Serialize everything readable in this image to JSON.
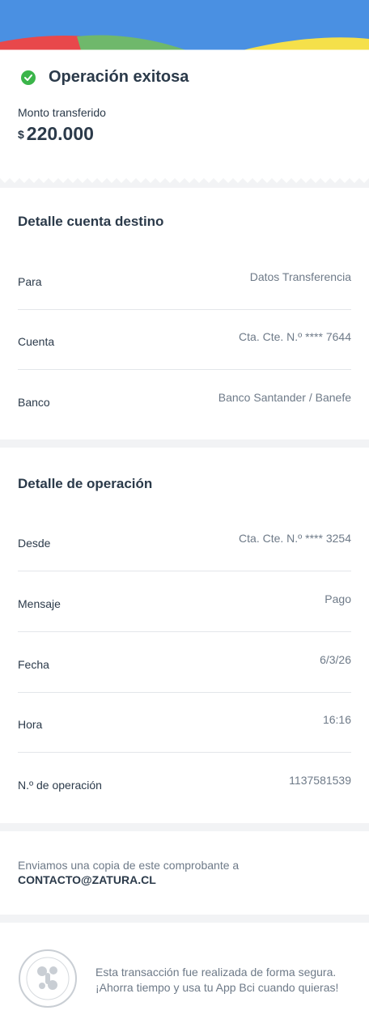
{
  "header": {
    "colors": {
      "blue": "#4a90e2",
      "red": "#e8484b",
      "green": "#6fb86b",
      "yellow": "#f5e04a"
    }
  },
  "status": {
    "title": "Operación exitosa",
    "icon": "check-circle-icon"
  },
  "amount": {
    "label": "Monto transferido",
    "currency": "$",
    "value": "220.000"
  },
  "destino": {
    "title": "Detalle cuenta destino",
    "rows": [
      {
        "label": "Para",
        "value": "Datos Transferencia"
      },
      {
        "label": "Cuenta",
        "value": "Cta. Cte. N.º **** 7644"
      },
      {
        "label": "Banco",
        "value": "Banco Santander / Banefe"
      }
    ]
  },
  "operacion": {
    "title": "Detalle de operación",
    "rows": [
      {
        "label": "Desde",
        "value": "Cta. Cte. N.º **** 3254"
      },
      {
        "label": "Mensaje",
        "value": "Pago"
      },
      {
        "label": "Fecha",
        "value": "6/3/26"
      },
      {
        "label": "Hora",
        "value": "16:16"
      },
      {
        "label": "N.º de operación",
        "value": "1137581539"
      }
    ]
  },
  "copy": {
    "text": "Enviamos una copia de este comprobante a",
    "email": "CONTACTO@ZATURA.CL"
  },
  "footer": {
    "seal_icon": "bci-seal-icon",
    "line1": "Esta transacción fue realizada de forma segura.",
    "line2": "¡Ahorra tiempo y usa tu App Bci cuando quieras!"
  }
}
